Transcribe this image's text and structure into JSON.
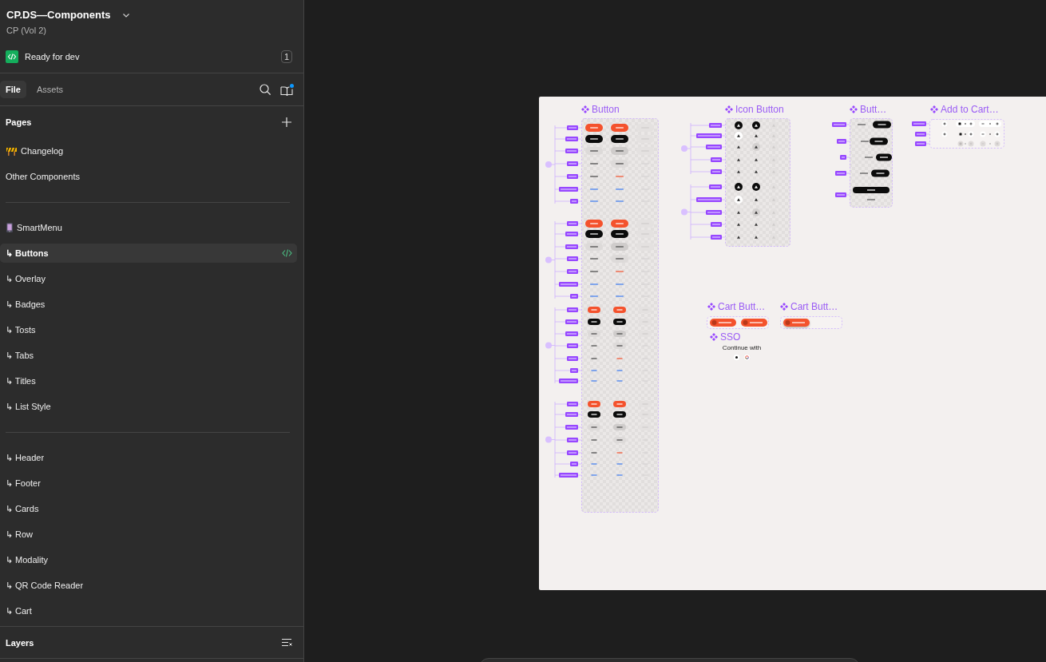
{
  "file": {
    "title": "CP.DS—Components",
    "project": "CP (Vol 2)"
  },
  "dev_status": {
    "label": "Ready for dev",
    "count": "1"
  },
  "tabs": [
    {
      "label": "File",
      "selected": true
    },
    {
      "label": "Assets",
      "selected": false
    }
  ],
  "pages": {
    "title": "Pages",
    "sections": [
      {
        "items": [
          {
            "label": "Changelog",
            "kind": "barrier",
            "selected": false,
            "ready_for_dev": false
          },
          {
            "label": "Other Components",
            "kind": "plain",
            "selected": false,
            "ready_for_dev": false
          }
        ]
      },
      {
        "items": [
          {
            "label": "SmartMenu",
            "kind": "phone",
            "selected": false,
            "ready_for_dev": false
          },
          {
            "label": "↳ Buttons",
            "kind": "plain",
            "selected": true,
            "ready_for_dev": true
          },
          {
            "label": "↳ Overlay",
            "kind": "plain",
            "selected": false,
            "ready_for_dev": false
          },
          {
            "label": "↳ Badges",
            "kind": "plain",
            "selected": false,
            "ready_for_dev": false
          },
          {
            "label": "↳ Tosts",
            "kind": "plain",
            "selected": false,
            "ready_for_dev": false
          },
          {
            "label": "↳ Tabs",
            "kind": "plain",
            "selected": false,
            "ready_for_dev": false
          },
          {
            "label": "↳ Titles",
            "kind": "plain",
            "selected": false,
            "ready_for_dev": false
          },
          {
            "label": "↳ List Style",
            "kind": "plain",
            "selected": false,
            "ready_for_dev": false
          }
        ]
      },
      {
        "items": [
          {
            "label": "↳ Header",
            "kind": "plain",
            "selected": false,
            "ready_for_dev": false
          },
          {
            "label": "↳ Footer",
            "kind": "plain",
            "selected": false,
            "ready_for_dev": false
          },
          {
            "label": "↳ Cards",
            "kind": "plain",
            "selected": false,
            "ready_for_dev": false
          },
          {
            "label": "↳ Row",
            "kind": "plain",
            "selected": false,
            "ready_for_dev": false
          },
          {
            "label": "↳ Modality",
            "kind": "plain",
            "selected": false,
            "ready_for_dev": false
          },
          {
            "label": "↳ QR Code Reader",
            "kind": "plain",
            "selected": false,
            "ready_for_dev": false
          },
          {
            "label": "↳ Cart",
            "kind": "plain",
            "selected": false,
            "ready_for_dev": false
          }
        ]
      }
    ]
  },
  "layers": {
    "title": "Layers"
  },
  "canvas": {
    "components": [
      {
        "title": "Button",
        "kind": "button_variants"
      },
      {
        "title": "Icon Button",
        "kind": "icon_button_variants"
      },
      {
        "title": "Butt…",
        "kind": "alignment_variants"
      },
      {
        "title": "Add to Cart…",
        "kind": "stepper_variants"
      },
      {
        "title": "Cart Butt…",
        "kind": "cart_buttons"
      },
      {
        "title": "Cart Butt…",
        "kind": "cart_button_floating"
      },
      {
        "title": "SSO",
        "kind": "sso",
        "prompt": "Continue with"
      }
    ]
  }
}
